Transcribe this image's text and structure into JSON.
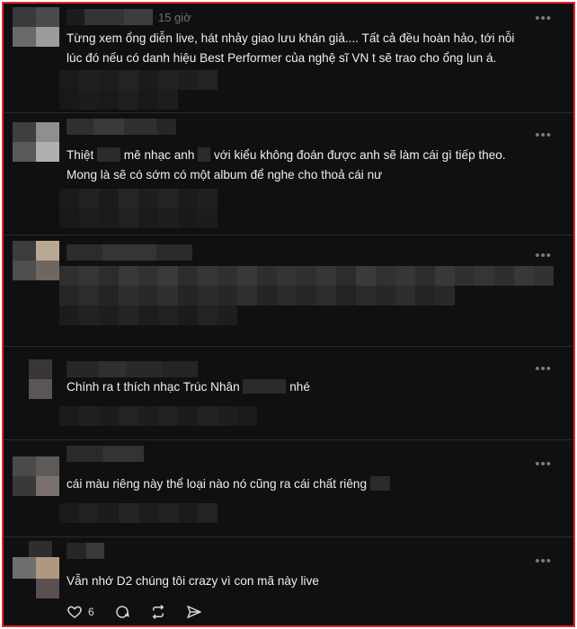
{
  "posts": [
    {
      "time": "15 giờ",
      "more": "•••",
      "lines": [
        "Từng xem ổng diễn live, hát nhảy giao lưu khán giả.... Tất cả đều hoàn hảo, tới nỗi",
        "lúc đó nếu có danh hiệu Best Performer của nghệ sĩ VN t sẽ trao cho ổng lun á."
      ]
    },
    {
      "more": "•••",
      "line1_a": "Thiệt",
      "line1_b": "mê nhạc anh",
      "line1_c": "với kiểu không đoán được anh sẽ làm cái gì tiếp theo.",
      "line2": "Mong là sẽ có sớm có một album để nghe cho thoả cái nư"
    },
    {
      "more": "•••"
    },
    {
      "more": "•••",
      "line_a": "Chính ra t thích nhạc Trúc Nhân",
      "line_b": "nhé"
    },
    {
      "more": "•••",
      "line": "cái màu riêng này thể loại nào nó cũng ra cái chất riêng"
    },
    {
      "more": "•••",
      "line": "Vẫn nhớ D2 chúng tôi crazy vì con mã này live"
    }
  ],
  "actions": {
    "like_count": "6",
    "icons": [
      "heart-icon",
      "comment-icon",
      "repost-icon",
      "share-icon"
    ]
  },
  "colors": {
    "background": "#101010",
    "border": "#e0262a",
    "text": "#efefef",
    "muted": "#6f6f6f"
  }
}
